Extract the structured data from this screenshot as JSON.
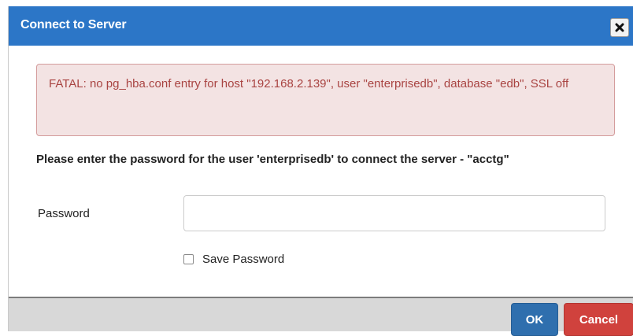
{
  "dialog": {
    "title": "Connect to Server",
    "error_message": "FATAL: no pg_hba.conf entry for host \"192.168.2.139\", user \"enterprisedb\", database \"edb\", SSL off",
    "prompt": "Please enter the password for the user 'enterprisedb' to connect the server - \"acctg\"",
    "password_label": "Password",
    "password_value": "",
    "save_password_label": "Save Password",
    "save_password_checked": false,
    "ok_label": "OK",
    "cancel_label": "Cancel"
  },
  "icons": {
    "close": "close-icon"
  },
  "colors": {
    "titlebar": "#2c76c7",
    "error_text": "#a94442",
    "error_bg": "#f3e3e3",
    "ok_button": "#2f6fae",
    "cancel_button": "#d0423d"
  }
}
